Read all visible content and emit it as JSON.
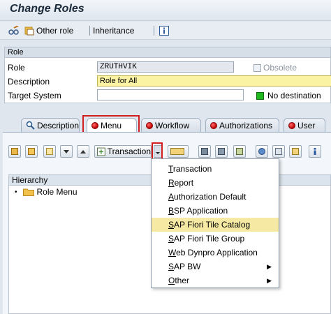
{
  "window": {
    "title": "Change Roles"
  },
  "toolbar": {
    "other_role": "Other role",
    "inheritance": "Inheritance"
  },
  "role_section": {
    "header": "Role",
    "role_label": "Role",
    "role_value": "ZRUTHVIK",
    "obsolete_label": "Obsolete",
    "description_label": "Description",
    "description_value": "Role for All",
    "target_label": "Target System",
    "target_value": "",
    "no_destination": "No destination"
  },
  "tabs": [
    {
      "label": "Description"
    },
    {
      "label": "Menu"
    },
    {
      "label": "Workflow"
    },
    {
      "label": "Authorizations"
    },
    {
      "label": "User"
    }
  ],
  "menu_toolbar": {
    "transaction_label": "Transaction"
  },
  "hierarchy": {
    "header": "Hierarchy",
    "root": "Role Menu"
  },
  "dropdown": {
    "items": [
      {
        "first": "T",
        "rest": "ransaction",
        "submenu": false
      },
      {
        "first": "R",
        "rest": "eport",
        "submenu": false
      },
      {
        "first": "A",
        "rest": "uthorization Default",
        "submenu": false
      },
      {
        "first": "B",
        "rest": "SP Application",
        "submenu": false
      },
      {
        "first": "S",
        "rest": "AP Fiori Tile Catalog",
        "submenu": false,
        "highlighted": true
      },
      {
        "first": "S",
        "rest": "AP Fiori Tile Group",
        "submenu": false
      },
      {
        "first": "W",
        "rest": "eb Dynpro Application",
        "submenu": false
      },
      {
        "first": "S",
        "rest": "AP BW",
        "submenu": true
      },
      {
        "first": "O",
        "rest": "ther",
        "submenu": true
      }
    ]
  },
  "colors": {
    "highlight": "#f6e9a3",
    "status_green": "#1fb81f",
    "tab_status_red": "#c00000",
    "annotation_red": "#d21f1f"
  }
}
